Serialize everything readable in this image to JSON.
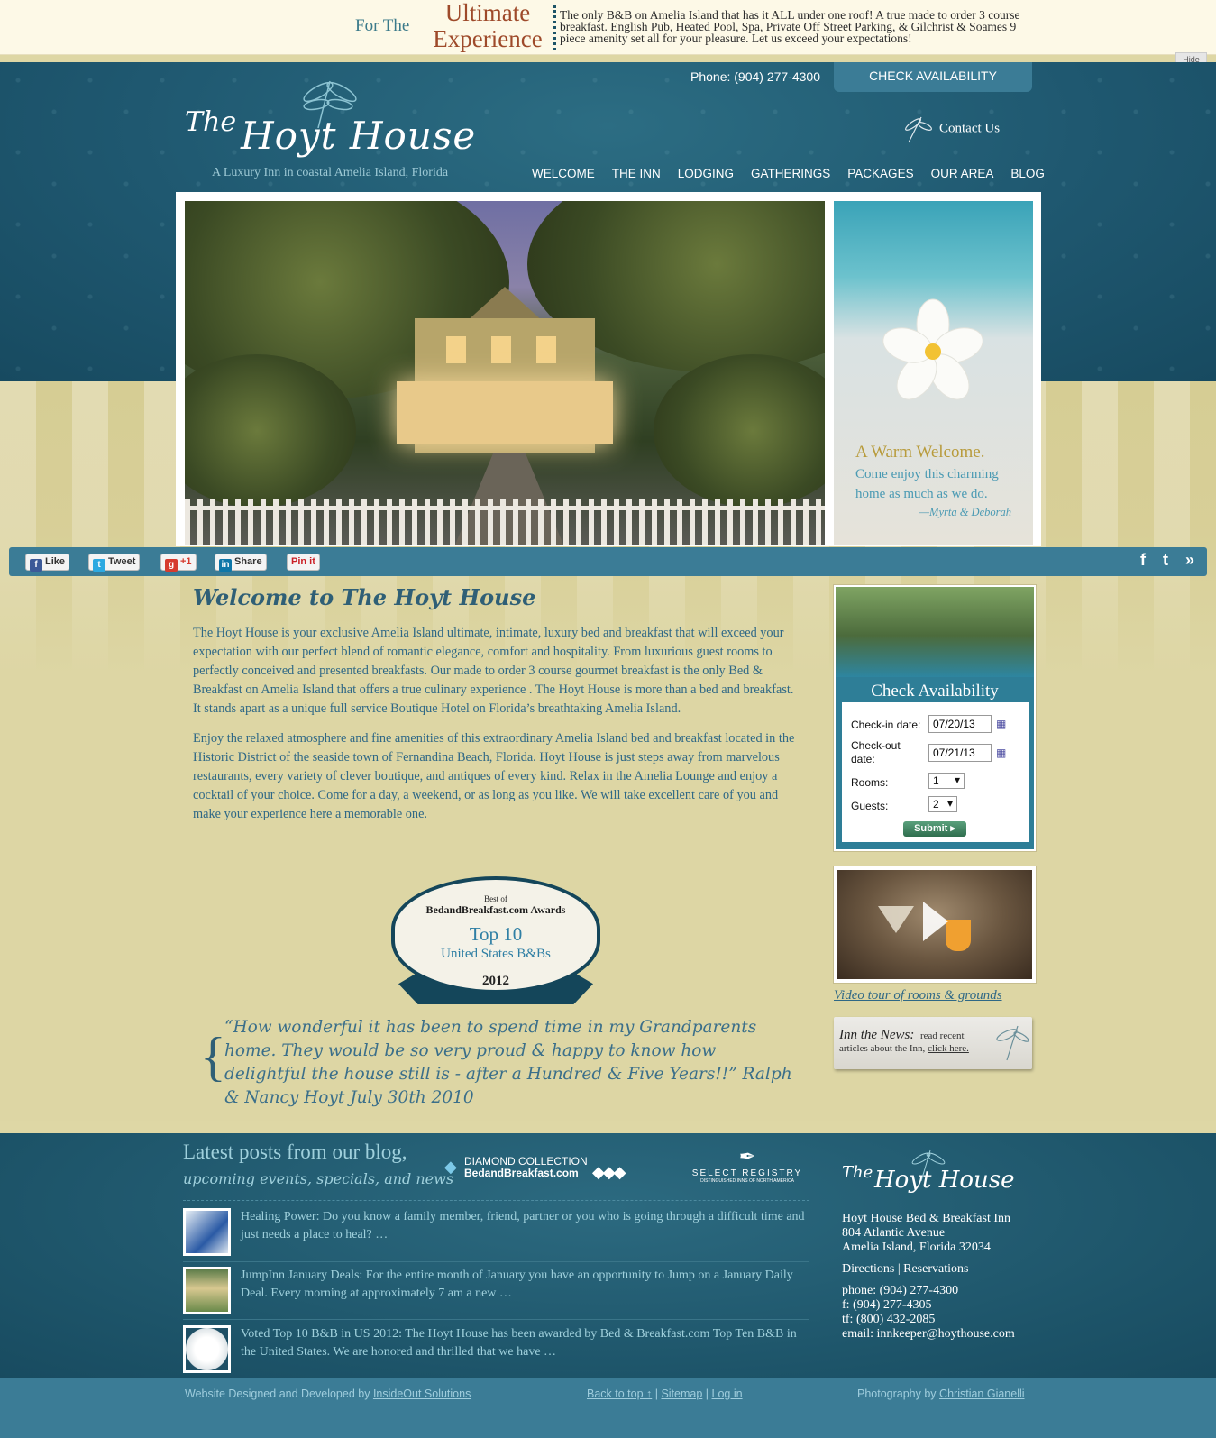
{
  "promo": {
    "for_the": "For The",
    "ultimate": "Ultimate",
    "experience": "Experience",
    "text": "The only B&B on Amelia Island that has it ALL under one roof! A true made to order 3 course breakfast. English Pub, Heated Pool, Spa, Private Off Street Parking, & Gilchrist & Soames 9 piece amenity set all for your pleasure. Let us exceed your expectations!",
    "hide_label": "Hide"
  },
  "header": {
    "phone": "Phone: (904) 277-4300",
    "check_availability": "CHECK AVAILABILITY",
    "logo_the": "The",
    "logo_hoyt": "Hoyt House",
    "logo_tagline": "A Luxury Inn  in coastal Amelia Island, Florida",
    "contact": "Contact Us",
    "nav": [
      "WELCOME",
      "THE INN",
      "LODGING",
      "GATHERINGS",
      "PACKAGES",
      "OUR AREA",
      "BLOG"
    ]
  },
  "welcome_card": {
    "title": "A Warm Welcome.",
    "body": "Come enjoy this charming home as much as we do.",
    "signature": "—Myrta & Deborah"
  },
  "social": {
    "like": "Like",
    "tweet": "Tweet",
    "plus": "+1",
    "share": "Share",
    "pin": "Pin it",
    "facebook_icon": "f",
    "twitter_icon": "t",
    "more_icon": "»"
  },
  "main": {
    "title": "Welcome to The Hoyt House",
    "paragraphs": [
      "The Hoyt House is your exclusive Amelia Island ultimate, intimate, luxury bed and breakfast that will exceed your expectation with our perfect blend of romantic elegance, comfort and hospitality. From luxurious guest rooms to perfectly conceived and presented breakfasts. Our made to order 3 course gourmet breakfast is the only Bed & Breakfast on Amelia Island that offers a true culinary experience . The Hoyt House is more than a bed and breakfast. It stands apart as a unique full service Boutique Hotel on Florida’s breathtaking Amelia Island.",
      "Enjoy the relaxed atmosphere and fine amenities of this extraordinary Amelia Island bed and breakfast located in the Historic District of the seaside town of Fernandina Beach, Florida. Hoyt House is just steps away from marvelous restaurants, every variety of clever boutique, and antiques of every kind. Relax in the Amelia Lounge and enjoy a cocktail of your choice. Come for a day, a weekend, or as long as you like.  We will take excellent care of you and make your experience here a memorable one."
    ],
    "badge": {
      "best_of": "Best of",
      "awards": "BedandBreakfast.com Awards",
      "top": "Top 10",
      "us": "United States B&Bs",
      "year": "2012"
    },
    "quote": "“How wonderful it has been to spend time in my Grandparents home. They would be so very proud & happy to know how delightful the house still is - after a Hundred & Five Years!!” Ralph & Nancy Hoyt July 30th 2010"
  },
  "availability": {
    "title": "Check Availability",
    "checkin_label": "Check-in date:",
    "checkin_value": "07/20/13",
    "checkout_label": "Check-out date:",
    "checkout_value": "07/21/13",
    "rooms_label": "Rooms:",
    "rooms_value": "1",
    "guests_label": "Guests:",
    "guests_value": "2",
    "submit": "Submit ▸"
  },
  "sidebar": {
    "video_link": "Video tour of rooms & grounds",
    "news_title": "Inn the News:",
    "news_text1": "read recent",
    "news_text2": "articles about the Inn,",
    "news_link": "click here."
  },
  "footer": {
    "blog_title": "Latest posts from our blog,",
    "blog_subtitle": "upcoming events, specials, and news",
    "partner_diamond_1": "DIAMOND COLLECTION",
    "partner_diamond_2": "BedandBreakfast.com",
    "partner_select": "SELECT REGISTRY",
    "partner_select_sub": "DISTINGUISHED INNS OF NORTH AMERICA",
    "posts": [
      "Healing Power: Do you know a family member, friend, partner or you who is going through a difficult time and just needs a place to heal?   …",
      "JumpInn January Deals: For the entire month of January  you have an opportunity to Jump on a January Daily Deal. Every morning at approximately 7 am a new …",
      "Voted Top 10 B&B in US 2012: The Hoyt House has been awarded by Bed & Breakfast.com Top Ten B&B in the United States. We are honored and thrilled that we have …"
    ],
    "logo_the": "The",
    "logo_hoyt": "Hoyt House",
    "address": [
      "Hoyt House Bed & Breakfast Inn",
      "804 Atlantic Avenue",
      "Amelia Island, Florida 32034"
    ],
    "links": "Directions | Reservations",
    "phone": "phone: (904) 277-4300",
    "fax": "f: (904) 277-4305",
    "tollfree": "tf: (800) 432-2085",
    "email": "email: innkeeper@hoythouse.com"
  },
  "bottom": {
    "designed_by": "Website Designed and Developed by ",
    "designer": "InsideOut Solutions",
    "back_to_top": "Back to top ↑",
    "sep": " | ",
    "sitemap": "Sitemap",
    "login": "Log in",
    "photo_by": "Photography by ",
    "photographer": "Christian Gianelli"
  }
}
